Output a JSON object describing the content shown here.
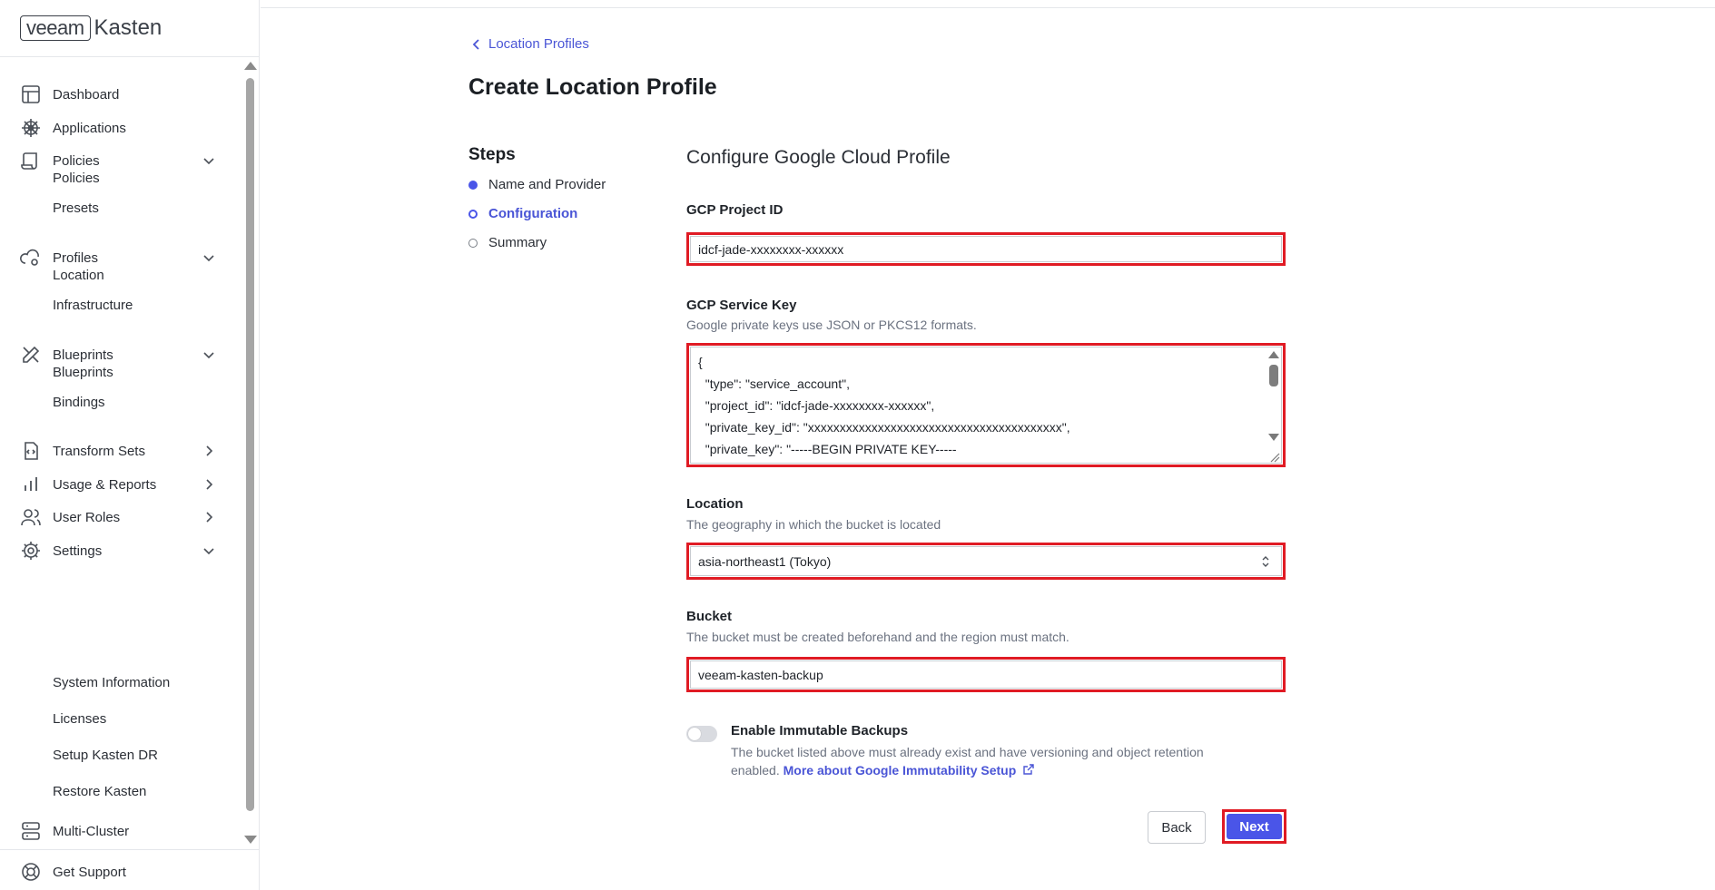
{
  "brand": {
    "logo_box": "veeam",
    "logo_text": "Kasten"
  },
  "sidebar": {
    "items": [
      {
        "label": "Dashboard",
        "icon": "dashboard-icon"
      },
      {
        "label": "Applications",
        "icon": "helm-wheel-icon"
      },
      {
        "label": "Policies",
        "icon": "scroll-icon",
        "chevron": "down"
      },
      {
        "label": "Profiles",
        "icon": "cloud-gear-icon",
        "chevron": "down"
      },
      {
        "label": "Blueprints",
        "icon": "ruler-pencil-icon",
        "chevron": "down"
      },
      {
        "label": "Transform Sets",
        "icon": "transform-doc-icon",
        "chevron": "right"
      },
      {
        "label": "Usage & Reports",
        "icon": "bar-chart-icon",
        "chevron": "right"
      },
      {
        "label": "User Roles",
        "icon": "users-icon",
        "chevron": "right"
      },
      {
        "label": "Settings",
        "icon": "gear-icon",
        "chevron": "down"
      },
      {
        "label": "Multi-Cluster",
        "icon": "server-icon"
      }
    ],
    "policies_sub": [
      "Policies",
      "Presets"
    ],
    "profiles_sub": [
      "Location",
      "Infrastructure"
    ],
    "blueprints_sub": [
      "Blueprints",
      "Bindings"
    ],
    "settings_sub": [
      "System Information",
      "Licenses",
      "Setup Kasten DR",
      "Restore Kasten"
    ],
    "get_support": "Get Support"
  },
  "breadcrumb": {
    "label": "Location Profiles"
  },
  "page_title": "Create Location Profile",
  "steps": {
    "title": "Steps",
    "items": [
      {
        "label": "Name and Provider",
        "state": "done"
      },
      {
        "label": "Configuration",
        "state": "current"
      },
      {
        "label": "Summary",
        "state": "pending"
      }
    ]
  },
  "form": {
    "title": "Configure Google Cloud Profile",
    "project_id": {
      "label": "GCP Project ID",
      "value": "idcf-jade-xxxxxxxx-xxxxxx"
    },
    "service_key": {
      "label": "GCP Service Key",
      "help": "Google private keys use JSON or PKCS12 formats.",
      "lines": [
        "{",
        "  \"type\": \"service_account\",",
        "  \"project_id\": \"idcf-jade-xxxxxxxx-xxxxxx\",",
        "  \"private_key_id\": \"xxxxxxxxxxxxxxxxxxxxxxxxxxxxxxxxxxxxxxxx\",",
        "  \"private_key\": \"-----BEGIN PRIVATE KEY-----"
      ]
    },
    "location": {
      "label": "Location",
      "help": "The geography in which the bucket is located",
      "value": "asia-northeast1 (Tokyo)"
    },
    "bucket": {
      "label": "Bucket",
      "help": "The bucket must be created beforehand and the region must match.",
      "value": "veeam-kasten-backup"
    },
    "immutable": {
      "label": "Enable Immutable Backups",
      "desc": "The bucket listed above must already exist and have versioning and object retention enabled.",
      "link": "More about Google Immutability Setup",
      "enabled": false
    },
    "back_label": "Back",
    "next_label": "Next"
  },
  "colors": {
    "accent": "#4a55e8",
    "highlight": "#e01b24"
  }
}
